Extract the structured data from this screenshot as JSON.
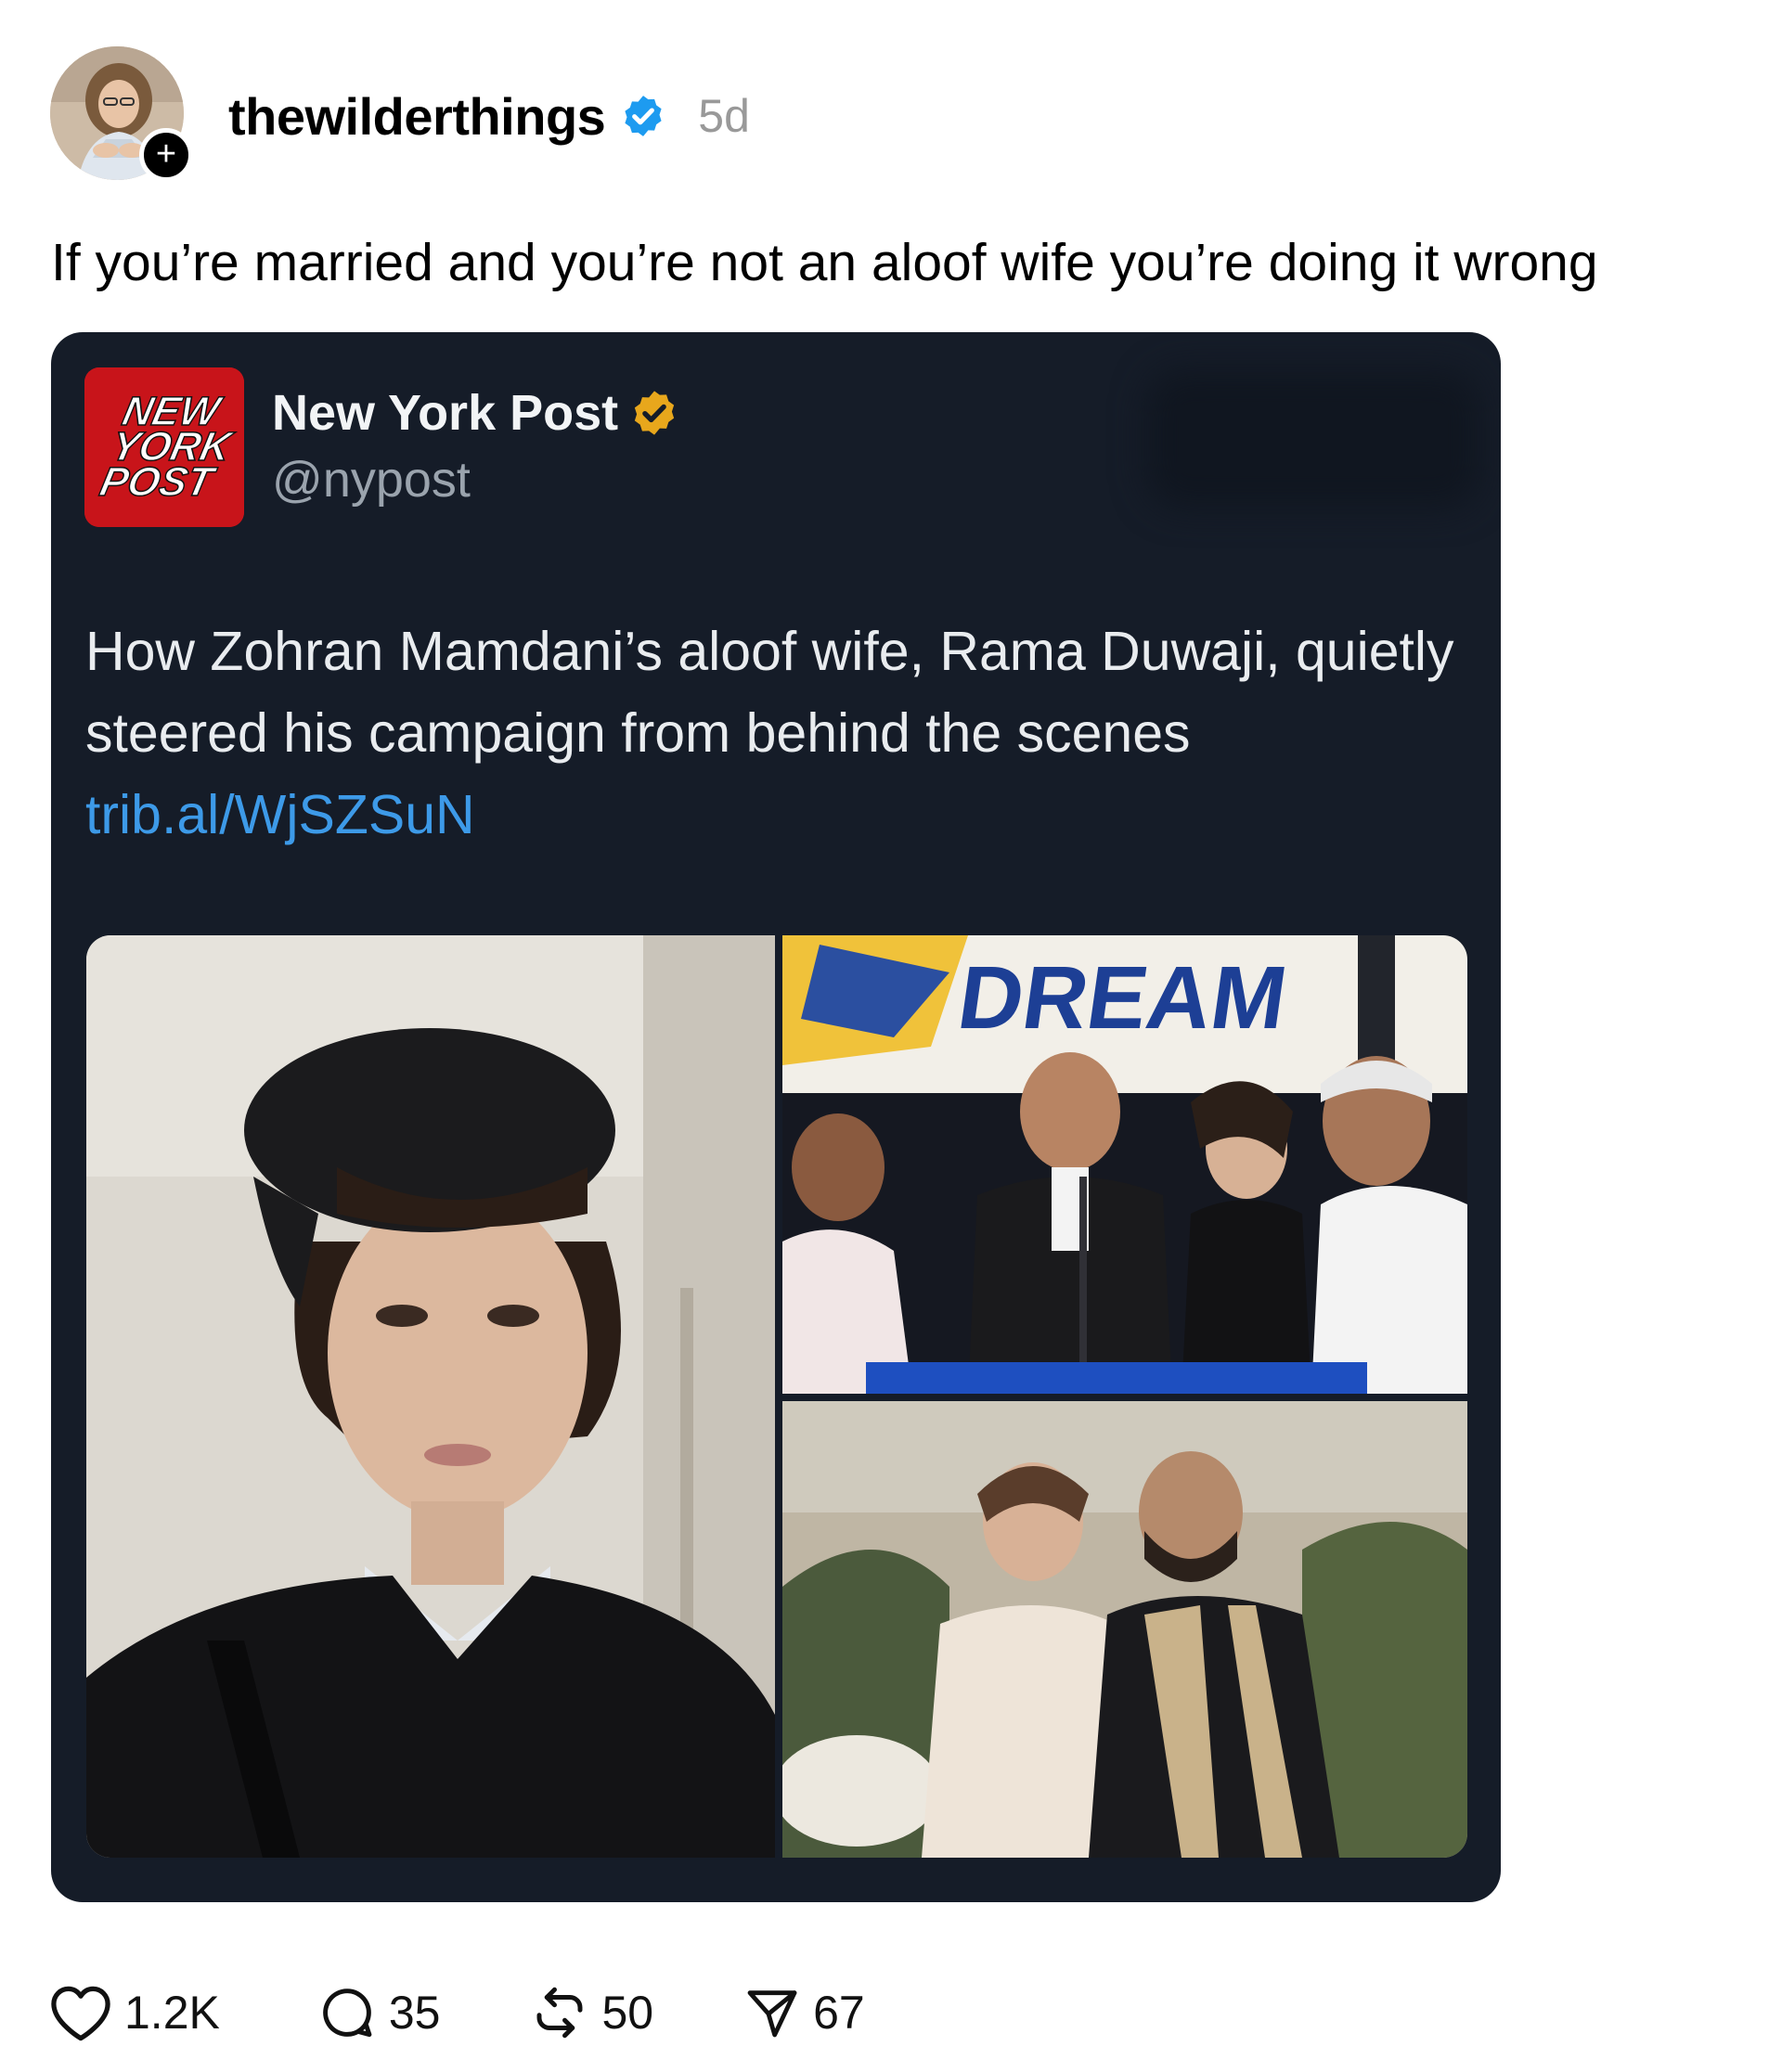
{
  "post": {
    "author": {
      "username": "thewilderthings",
      "verified": true,
      "timestamp": "5d",
      "avatar_icon": "profile-photo",
      "follow_icon": "plus-icon"
    },
    "caption": "If you’re married and you’re not an aloof wife you’re doing it wrong",
    "embedded_tweet": {
      "account_name": "New York Post",
      "handle": "@nypost",
      "verified_badge_color": "#e8a71c",
      "logo_text": [
        "NEW",
        "YORK",
        "POST"
      ],
      "logo_color": "#c8141a",
      "text": "How Zohran Mamdani’s aloof wife, Rama Duwaji, quietly steered his campaign from behind the scenes ",
      "link": "trib.al/WjSZSuN",
      "link_color": "#3d9ae8",
      "card_background": "#151c28",
      "photos": [
        {
          "name": "selfie-photo",
          "sign_text": ""
        },
        {
          "name": "campaign-stage-photo",
          "sign_text": "DREAM"
        },
        {
          "name": "wedding-photo",
          "sign_text": ""
        }
      ]
    },
    "actions": {
      "likes": "1.2K",
      "replies": "35",
      "reposts": "50",
      "shares": "67"
    }
  },
  "colors": {
    "verified_blue": "#1d9bf0",
    "timestamp_gray": "#999999"
  }
}
